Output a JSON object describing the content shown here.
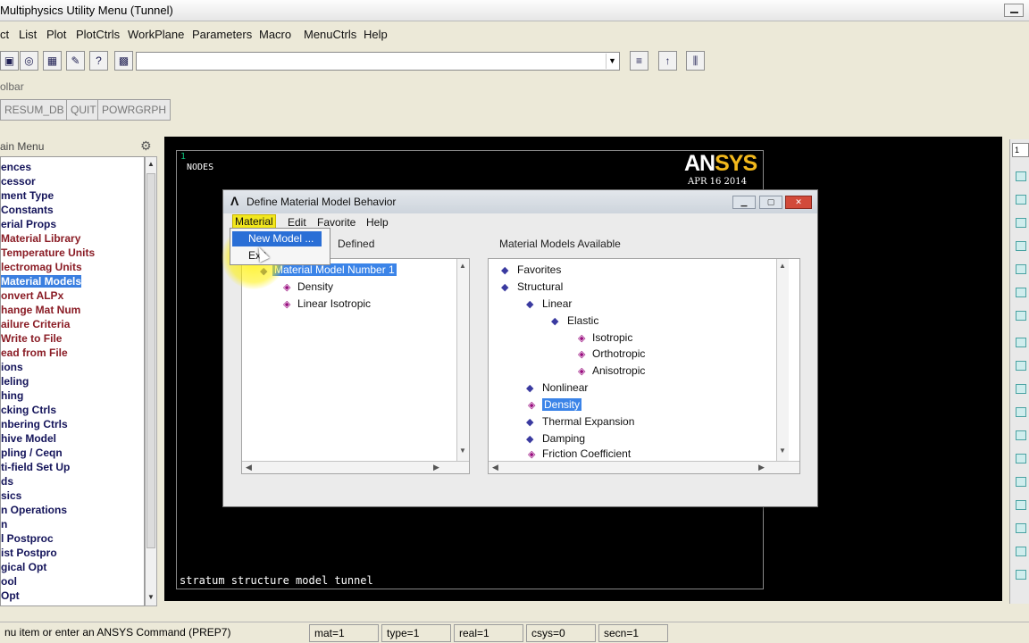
{
  "window": {
    "title": "Multiphysics Utility Menu (Tunnel)"
  },
  "menubar": [
    "ct",
    "List",
    "Plot",
    "PlotCtrls",
    "WorkPlane",
    "Parameters",
    "Macro",
    "MenuCtrls",
    "Help"
  ],
  "toolbar": {
    "label": "olbar",
    "buttons": [
      "RESUM_DB",
      "QUIT",
      "POWRGRPH"
    ]
  },
  "main_menu": {
    "header": "ain Menu",
    "items": [
      "ences",
      "cessor",
      "ment Type",
      "Constants",
      "erial Props",
      "Material Library",
      "Temperature Units",
      "lectromag Units",
      "Material Models",
      "onvert ALPx",
      "hange Mat Num",
      "ailure Criteria",
      "Write to File",
      "ead from File",
      "ions",
      "leling",
      "hing",
      "cking Ctrls",
      "nbering Ctrls",
      "hive Model",
      "pling / Ceqn",
      "ti-field Set Up",
      "ds",
      "sics",
      "n Operations",
      "n",
      "l Postproc",
      "ist Postpro",
      "gical Opt",
      "ool",
      "Opt"
    ],
    "selected": "Material Models"
  },
  "graphics": {
    "window_number": "1",
    "label": "NODES",
    "logo_a": "AN",
    "logo_b": "SYS",
    "date": "APR 16 2014",
    "caption": "stratum structure model tunnel"
  },
  "right_toolbar": {
    "selector": "1"
  },
  "dialog": {
    "title": "Define Material Model Behavior",
    "menu": [
      "Material",
      "Edit",
      "Favorite",
      "Help"
    ],
    "dropdown": {
      "new_model": "New Model ...",
      "exit": "Exit"
    },
    "defined_title": "Defined",
    "defined_tree": {
      "root": "Material Model Number 1",
      "children": [
        "Density",
        "Linear Isotropic"
      ]
    },
    "available_title": "Material Models Available",
    "available_tree": {
      "favorites": "Favorites",
      "structural": "Structural",
      "linear": "Linear",
      "elastic": "Elastic",
      "isotropic": "Isotropic",
      "orthotropic": "Orthotropic",
      "anisotropic": "Anisotropic",
      "nonlinear": "Nonlinear",
      "density": "Density",
      "thermal": "Thermal Expansion",
      "damping": "Damping",
      "friction": "Friction Coefficient"
    }
  },
  "status": {
    "prompt": "nu item or enter an ANSYS Command (PREP7)",
    "mat": "mat=1",
    "type": "type=1",
    "real": "real=1",
    "csys": "csys=0",
    "secn": "secn=1"
  },
  "colors": {
    "logo_yellow": "#f2b81c",
    "selection": "#3b7fe0",
    "menu_highlight": "#f2e71d"
  }
}
